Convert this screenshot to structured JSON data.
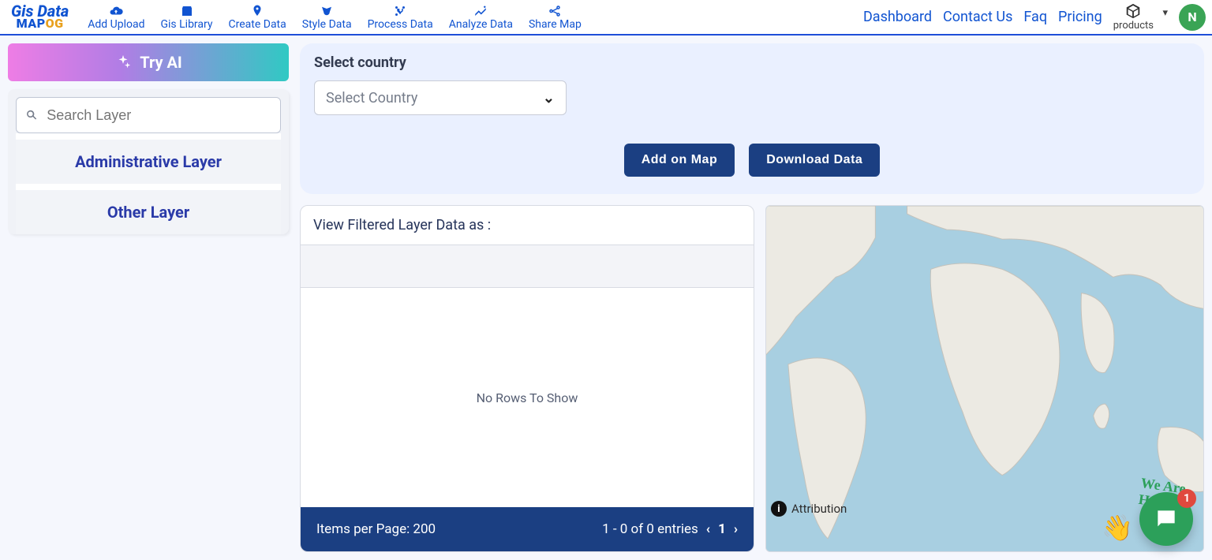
{
  "logo": {
    "line1": "Gis Data",
    "line2a": "MAP",
    "line2b": "OG"
  },
  "topnav": {
    "add_upload": "Add Upload",
    "gis_library": "Gis Library",
    "create_data": "Create Data",
    "style_data": "Style Data",
    "process_data": "Process Data",
    "analyze_data": "Analyze Data",
    "share_map": "Share Map"
  },
  "rightnav": {
    "dashboard": "Dashboard",
    "contact": "Contact Us",
    "faq": "Faq",
    "pricing": "Pricing",
    "products": "products",
    "avatar_initial": "N"
  },
  "sidebar": {
    "try_ai": "Try AI",
    "search_placeholder": "Search Layer",
    "item_admin": "Administrative Layer",
    "item_other": "Other Layer"
  },
  "controls": {
    "label": "Select country",
    "select_placeholder": "Select Country",
    "add_on_map": "Add on Map",
    "download": "Download Data"
  },
  "data_card": {
    "title": "View Filtered Layer Data as :",
    "empty": "No Rows To Show",
    "items_per_page_label": "Items per Page: ",
    "items_per_page_value": "200",
    "entries_text": "1 - 0 of 0 entries",
    "page_current": "1"
  },
  "map": {
    "attribution": "Attribution"
  },
  "chat": {
    "halo": "We Are Here!",
    "badge": "1",
    "wave_emoji": "👋"
  }
}
